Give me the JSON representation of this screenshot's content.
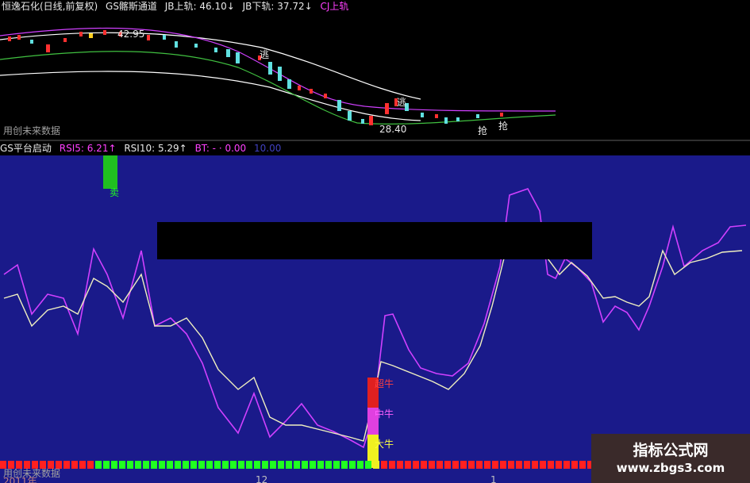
{
  "top": {
    "stock_name": "恒逸石化(日线,前复权)",
    "channel_name": "GS髂斯通道",
    "jb_upper": "JB上轨: 46.10↓",
    "jb_lower": "JB下轨: 37.72↓",
    "cj_upper": "CJ上轨",
    "price_high": "42.95",
    "price_low": "28.40",
    "mark_escape": "逃",
    "mark_grab": "抢",
    "footer": "用创未来数据"
  },
  "indicator": {
    "name": "GS平台启动",
    "rsi5": "RSI5: 6.21↑",
    "rsi10": "RSI10: 5.29↑",
    "bt": "BT: - · 0.00",
    "extra": "10.00"
  },
  "main": {
    "sell_label": "卖",
    "super_bull": "超牛",
    "mid_bull": "中牛",
    "big_bull": "大牛",
    "footer": "用创未来数据",
    "year": "2011年",
    "tick_12": "12",
    "tick_1": "1"
  },
  "watermark": {
    "title": "指标公式网",
    "url": "www.zbgs3.com"
  },
  "colors": {
    "main_bg": "#1a1a8a",
    "rsi5_line": "#d040ff",
    "rsi10_line": "#f0f0c0",
    "up_bar": "#ff2020",
    "down_bar": "#20ff20"
  }
}
